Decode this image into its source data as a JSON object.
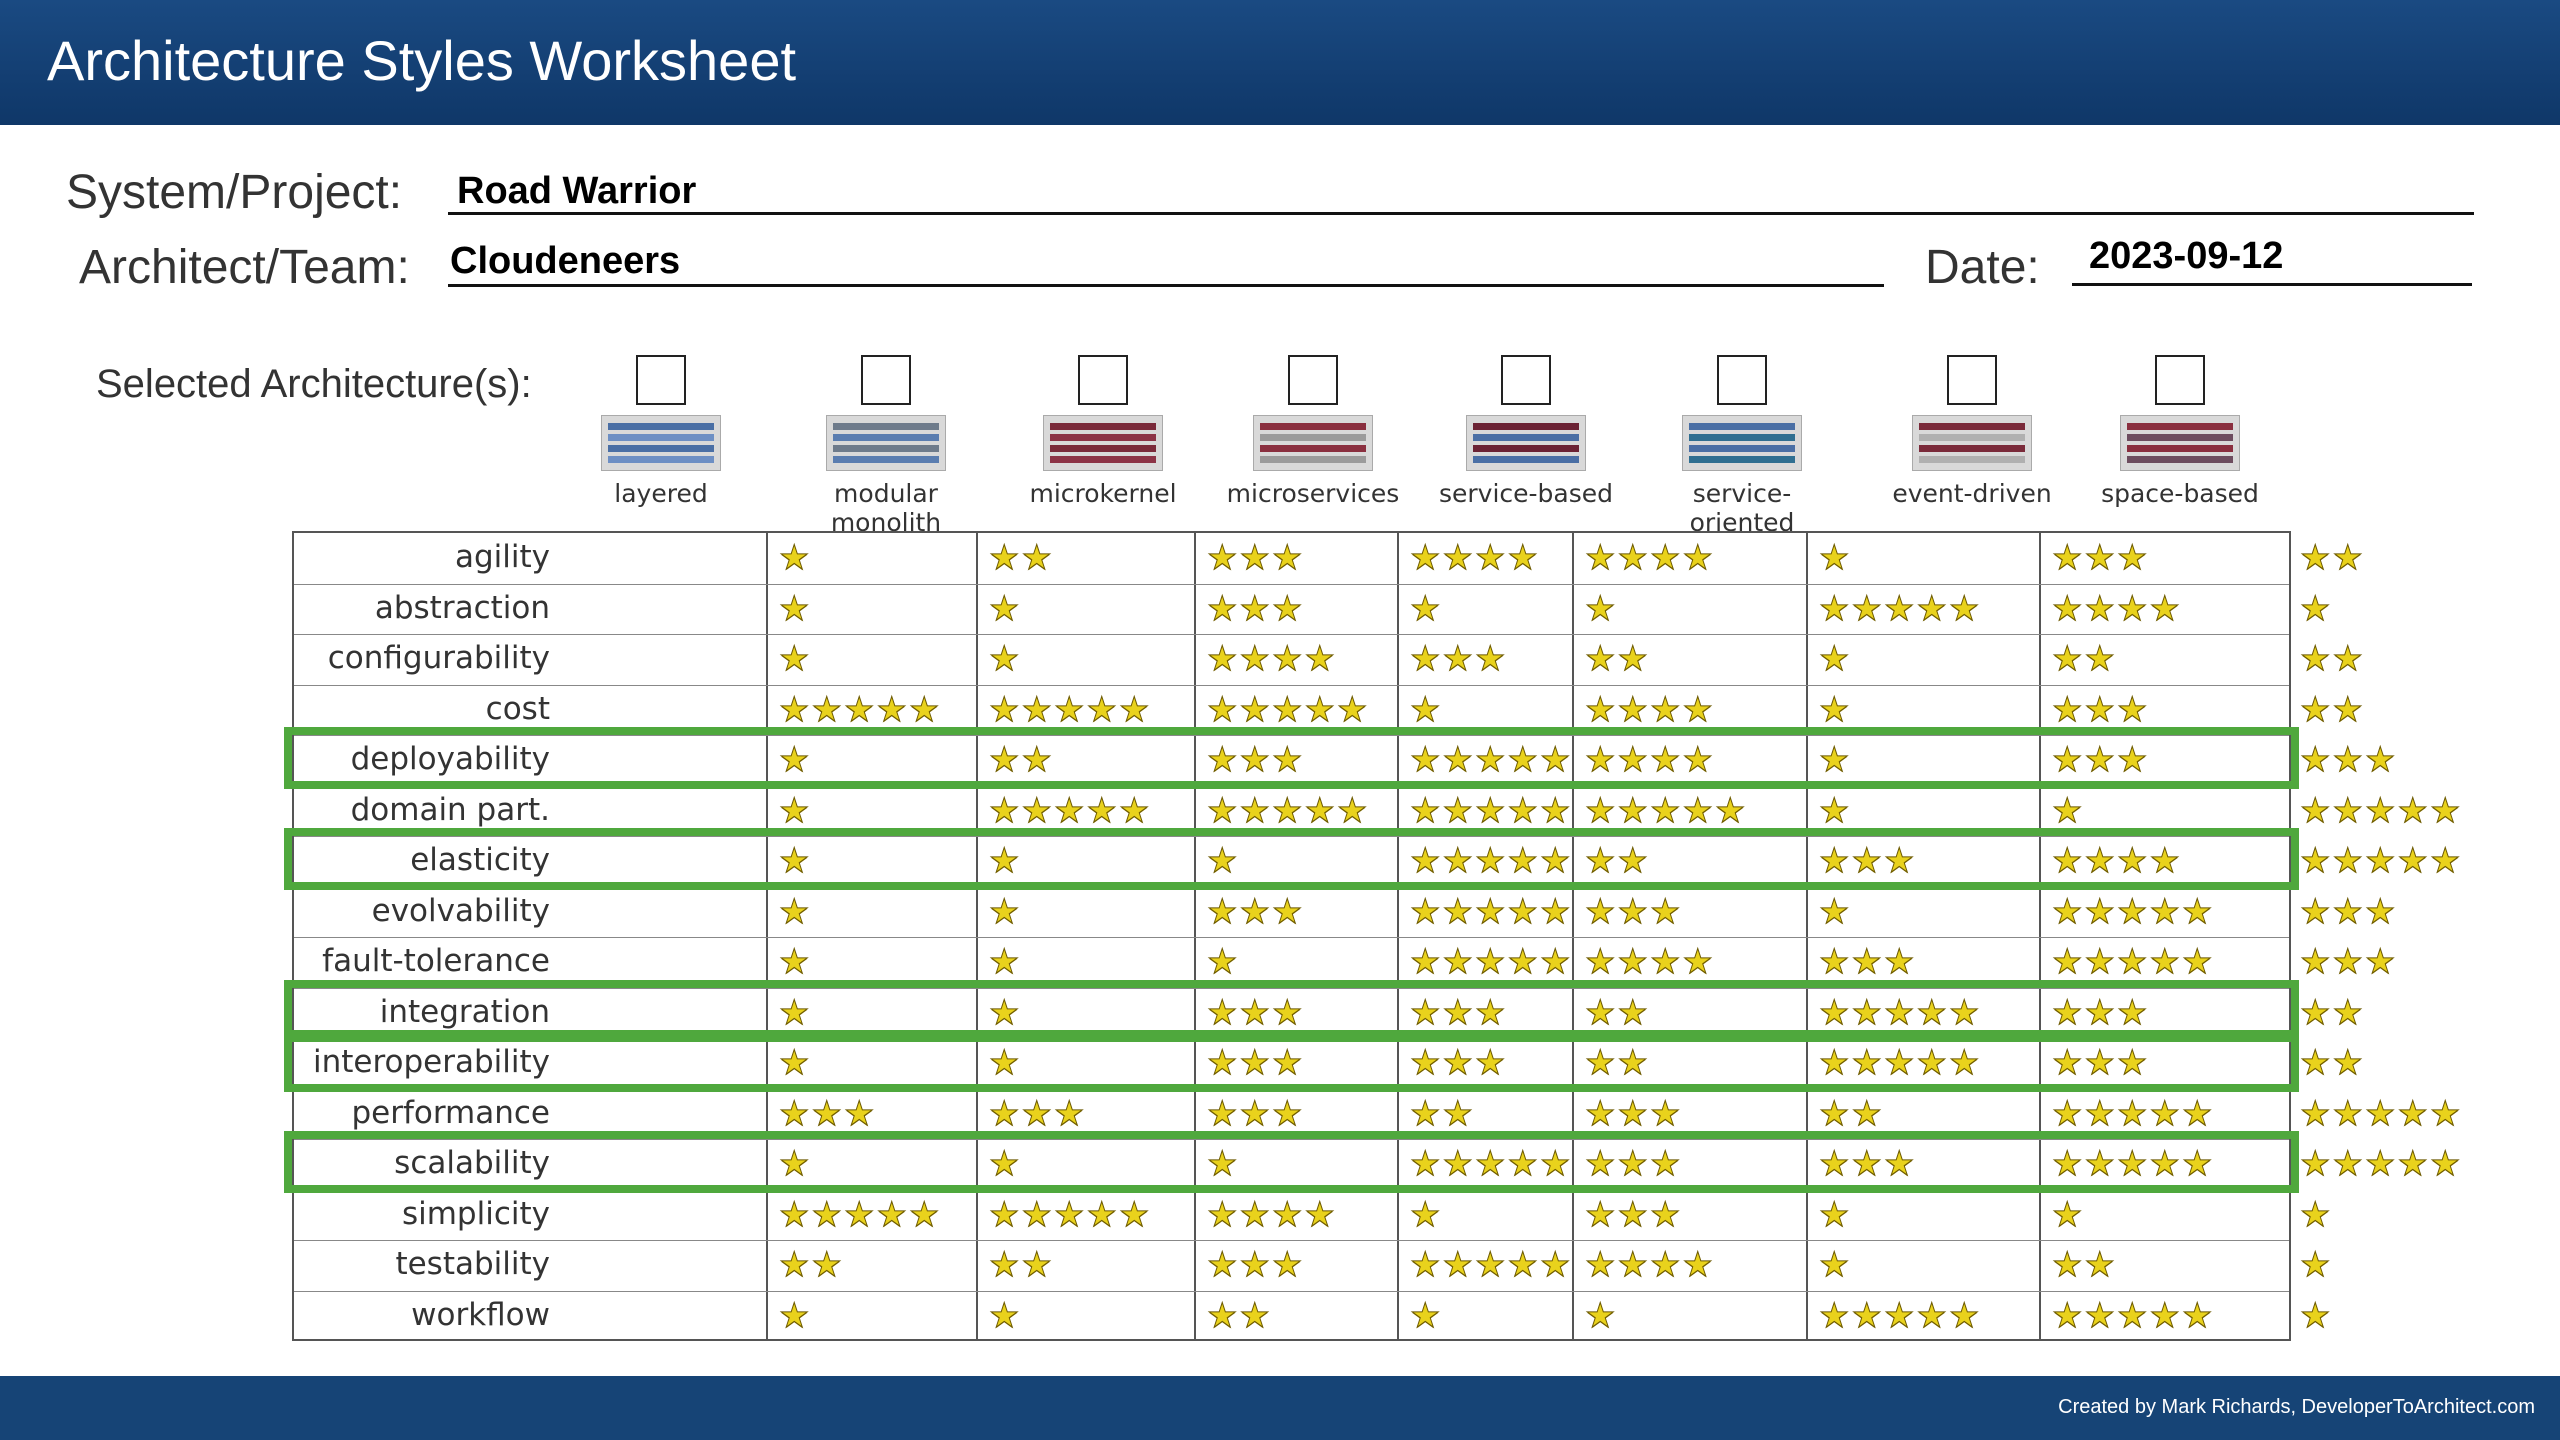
{
  "title": "Architecture Styles Worksheet",
  "form": {
    "project_label": "System/Project:",
    "project_value": "Road Warrior",
    "team_label": "Architect/Team:",
    "team_value": "Cloudeneers",
    "date_label": "Date:",
    "date_value": "2023-09-12",
    "selected_label": "Selected Architecture(s):"
  },
  "architectures": [
    {
      "name": "layered",
      "checked": false
    },
    {
      "name": "modular monolith",
      "checked": false
    },
    {
      "name": "microkernel",
      "checked": false
    },
    {
      "name": "microservices",
      "checked": false
    },
    {
      "name": "service-based",
      "checked": false
    },
    {
      "name": "service-oriented",
      "checked": false
    },
    {
      "name": "event-driven",
      "checked": false
    },
    {
      "name": "space-based",
      "checked": false
    }
  ],
  "star_icon": "star-icon",
  "highlight_color": "#4fa83d",
  "star_color": "#e9d21c",
  "attributes": [
    {
      "label": "agility",
      "ratings": [
        1,
        2,
        3,
        4,
        4,
        1,
        3,
        2
      ],
      "highlighted": false
    },
    {
      "label": "abstraction",
      "ratings": [
        1,
        1,
        3,
        1,
        1,
        5,
        4,
        1
      ],
      "highlighted": false
    },
    {
      "label": "configurability",
      "ratings": [
        1,
        1,
        4,
        3,
        2,
        1,
        2,
        2
      ],
      "highlighted": false
    },
    {
      "label": "cost",
      "ratings": [
        5,
        5,
        5,
        1,
        4,
        1,
        3,
        2
      ],
      "highlighted": false
    },
    {
      "label": "deployability",
      "ratings": [
        1,
        2,
        3,
        5,
        4,
        1,
        3,
        3
      ],
      "highlighted": true
    },
    {
      "label": "domain part.",
      "ratings": [
        1,
        5,
        5,
        5,
        5,
        1,
        1,
        5
      ],
      "highlighted": false
    },
    {
      "label": "elasticity",
      "ratings": [
        1,
        1,
        1,
        5,
        2,
        3,
        4,
        5
      ],
      "highlighted": true
    },
    {
      "label": "evolvability",
      "ratings": [
        1,
        1,
        3,
        5,
        3,
        1,
        5,
        3
      ],
      "highlighted": false
    },
    {
      "label": "fault-tolerance",
      "ratings": [
        1,
        1,
        1,
        5,
        4,
        3,
        5,
        3
      ],
      "highlighted": false
    },
    {
      "label": "integration",
      "ratings": [
        1,
        1,
        3,
        3,
        2,
        5,
        3,
        2
      ],
      "highlighted": true
    },
    {
      "label": "interoperability",
      "ratings": [
        1,
        1,
        3,
        3,
        2,
        5,
        3,
        2
      ],
      "highlighted": true
    },
    {
      "label": "performance",
      "ratings": [
        3,
        3,
        3,
        2,
        3,
        2,
        5,
        5
      ],
      "highlighted": false
    },
    {
      "label": "scalability",
      "ratings": [
        1,
        1,
        1,
        5,
        3,
        3,
        5,
        5
      ],
      "highlighted": true
    },
    {
      "label": "simplicity",
      "ratings": [
        5,
        5,
        4,
        1,
        3,
        1,
        1,
        1
      ],
      "highlighted": false
    },
    {
      "label": "testability",
      "ratings": [
        2,
        2,
        3,
        5,
        4,
        1,
        2,
        1
      ],
      "highlighted": false
    },
    {
      "label": "workflow",
      "ratings": [
        1,
        1,
        2,
        1,
        1,
        5,
        5,
        1
      ],
      "highlighted": false
    }
  ],
  "footer": {
    "credit": "Created by Mark Richards,  DeveloperToArchitect.com"
  }
}
